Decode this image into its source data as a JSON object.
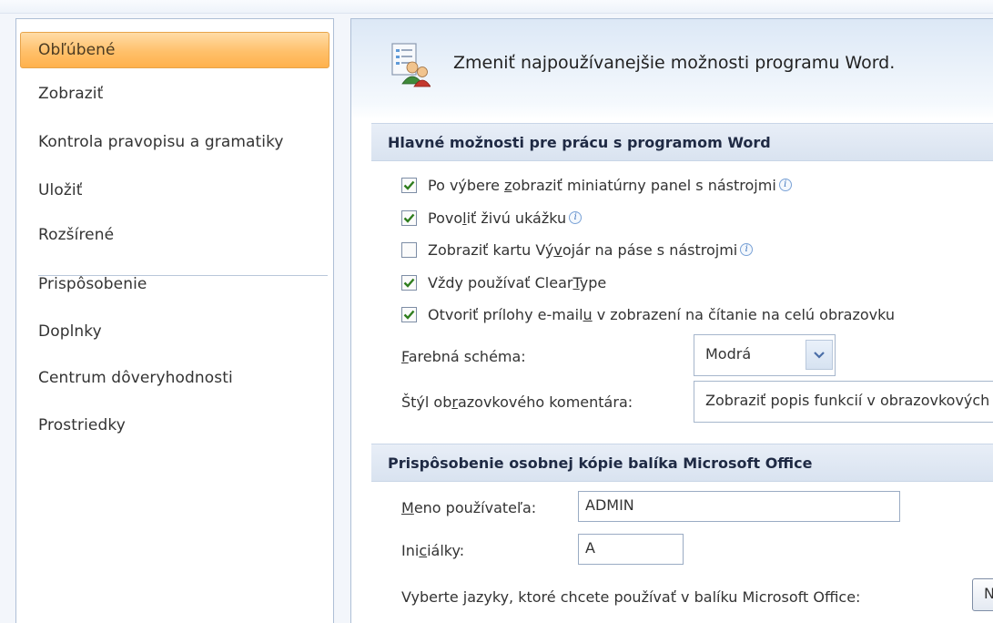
{
  "sidebar": {
    "items": [
      {
        "label": "Obľúbené"
      },
      {
        "label": "Zobraziť"
      },
      {
        "label": "Kontrola pravopisu a gramatiky"
      },
      {
        "label": "Uložiť"
      },
      {
        "label": "Rozšírené"
      },
      {
        "label": "Prispôsobenie"
      },
      {
        "label": "Doplnky"
      },
      {
        "label": "Centrum dôveryhodnosti"
      },
      {
        "label": "Prostriedky"
      }
    ]
  },
  "header": {
    "title": "Zmeniť najpoužívanejšie možnosti programu Word."
  },
  "section_main": {
    "title": "Hlavné možnosti pre prácu s programom Word",
    "options": [
      {
        "label": "Po výbere zobraziť miniatúrny panel s nástrojmi",
        "checked": true
      },
      {
        "label": "Povoliť živú ukážku",
        "checked": true
      },
      {
        "label": "Zobraziť kartu Vývojár na páse s nástrojmi",
        "checked": false
      },
      {
        "label": "Vždy používať ClearType",
        "checked": true
      },
      {
        "label": "Otvoriť prílohy e-mailu v zobrazení na čítanie na celú obrazovku",
        "checked": true
      }
    ],
    "color_scheme": {
      "label": "Farebná schéma:",
      "value": "Modrá"
    },
    "screentip_style": {
      "label": "Štýl obrazovkového komentára:",
      "value": "Zobraziť popis funkcií v obrazovkových komentároch"
    }
  },
  "section_personalize": {
    "title": "Prispôsobenie osobnej kópie balíka Microsoft Office",
    "user_name": {
      "label": "Meno používateľa:",
      "value": "ADMIN"
    },
    "initials": {
      "label": "Iniciálky:",
      "value": "A"
    },
    "languages_text": "Vyberte jazyky, ktoré chcete používať v balíku Microsoft Office:",
    "languages_button": "Nastavenia jazyka..."
  },
  "colors": {
    "accent": "#ffc06a",
    "check": "#2f7d1e",
    "section_bg": "#dde6f2"
  },
  "icons": {
    "info": "info-icon",
    "header": "options-people-icon",
    "dropdown": "chevron-down-icon",
    "check": "checkmark-icon"
  }
}
